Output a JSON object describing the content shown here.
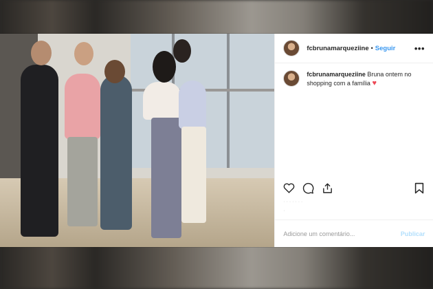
{
  "post": {
    "username": "fcbrunamarqueziine",
    "dot": "•",
    "follow_label": "Seguir",
    "more_label": "•••",
    "caption_user": "fcbrunamarqueziine",
    "caption_text": "Bruna ontem no shopping com a família",
    "caption_emoji": "♥",
    "meta_1": "· · · · · · ·",
    "meta_2": "·",
    "comment_placeholder": "Adicione um comentário...",
    "publish_label": "Publicar"
  },
  "colors": {
    "link": "#3897f0",
    "publish_disabled": "#b2dffc",
    "heart": "#ed4956",
    "text": "#262626"
  },
  "icons": {
    "like": "heart-outline-icon",
    "comment": "comment-bubble-icon",
    "share": "share-arrow-icon",
    "save": "bookmark-icon",
    "more": "more-options-icon"
  }
}
